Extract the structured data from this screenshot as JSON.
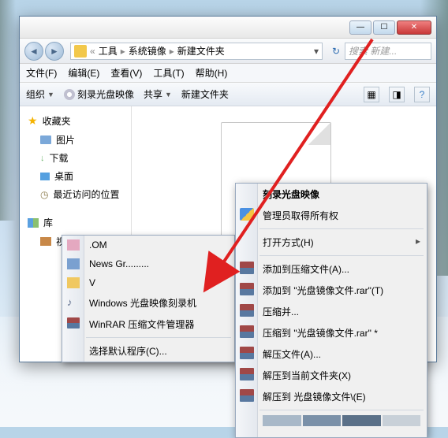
{
  "titlebar": {
    "min": "—",
    "max": "☐",
    "close": "✕"
  },
  "breadcrumb": {
    "lead": "«",
    "parts": [
      "工具",
      "系统镜像",
      "新建文件夹"
    ],
    "dropdown": "▾"
  },
  "search": {
    "placeholder": "搜索 新建..."
  },
  "menubar": {
    "file": "文件(F)",
    "edit": "编辑(E)",
    "view": "查看(V)",
    "tools": "工具(T)",
    "help": "帮助(H)"
  },
  "toolbar": {
    "organize": "组织",
    "burn": "刻录光盘映像",
    "share": "共享",
    "newfolder": "新建文件夹"
  },
  "sidebar": {
    "favorites_header": "收藏夹",
    "favorites": [
      "图片",
      "下载",
      "桌面",
      "最近访问的位置"
    ],
    "libraries_header": "库",
    "libraries": [
      "视频"
    ]
  },
  "submenu1": {
    "items_top": [
      ".OM",
      "News Gr.........",
      "V"
    ],
    "burner": "Windows 光盘映像刻录机",
    "winrar": "WinRAR 压缩文件管理器",
    "choose_default": "选择默认程序(C)..."
  },
  "contextmenu": {
    "burn_image": "刻录光盘映像",
    "admin_ownership": "管理员取得所有权",
    "open_with": "打开方式(H)",
    "add_to_archive": "添加到压缩文件(A)...",
    "add_to_named": "添加到 \"光盘镜像文件.rar\"(T)",
    "compress_and": "压缩并...",
    "compress_to_named": "压缩到 \"光盘镜像文件.rar\" *",
    "extract_files": "解压文件(A)...",
    "extract_here": "解压到当前文件夹(X)",
    "extract_to_named": "解压到 光盘镜像文件\\(E)"
  }
}
